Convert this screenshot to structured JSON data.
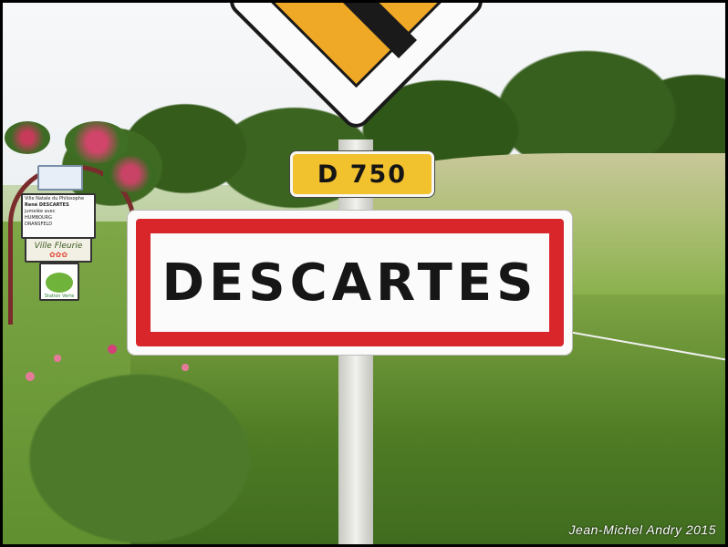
{
  "scene": {
    "description_free": true
  },
  "signs": {
    "road_number": "D 750",
    "town_name": "DESCARTES",
    "small_plaque_lines": [
      "Ville Natale du Philosophe",
      "René DESCARTES",
      "jumelée avec",
      "HUMBOURG",
      "DRANSFELD"
    ],
    "ville_fleurie": "Ville Fleurie",
    "station_verte": "Station Verte"
  },
  "credit": "Jean-Michel  Andry 2015",
  "colors": {
    "town_border": "#d8262b",
    "road_plate": "#f2c12e",
    "diamond_yellow": "#f0a827"
  }
}
